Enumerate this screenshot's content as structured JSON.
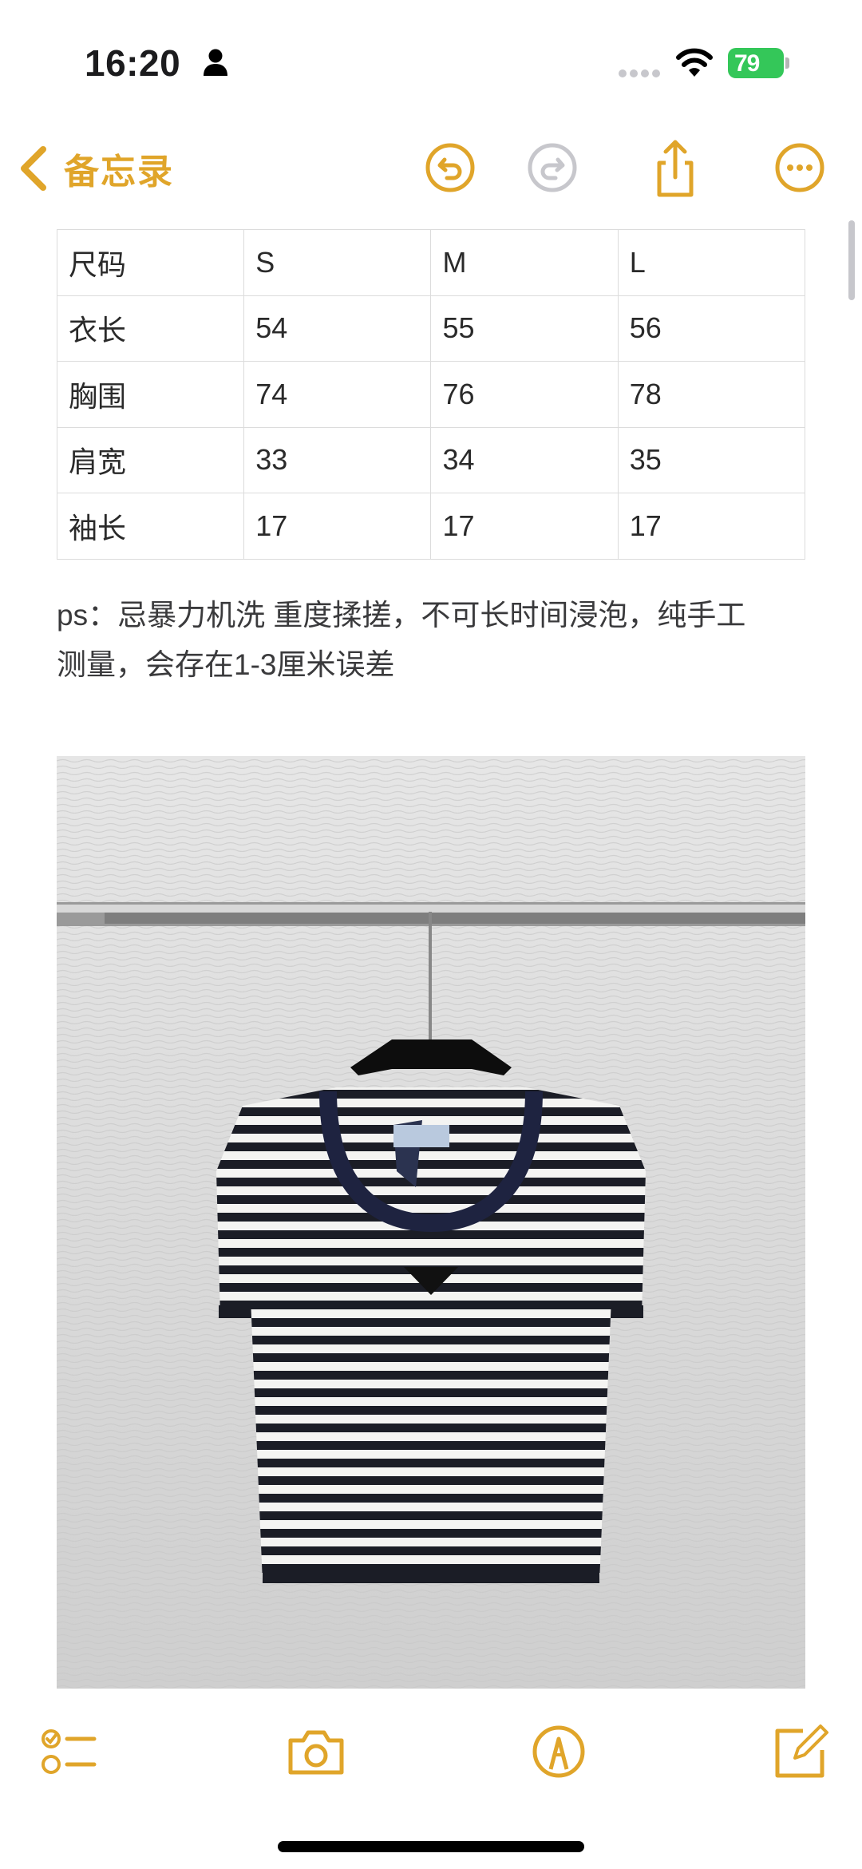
{
  "status_bar": {
    "time": "16:20",
    "battery": "79"
  },
  "nav": {
    "back_label": "备忘录",
    "icons": [
      "undo-icon",
      "redo-icon",
      "share-icon",
      "more-icon"
    ]
  },
  "colors": {
    "accent": "#E0A52A",
    "battery": "#34C759"
  },
  "table": {
    "rows": [
      [
        "尺码",
        "S",
        "M",
        "L"
      ],
      [
        "衣长",
        "54",
        "55",
        "56"
      ],
      [
        "胸围",
        "74",
        "76",
        "78"
      ],
      [
        "肩宽",
        "33",
        "34",
        "35"
      ],
      [
        "袖长",
        "17",
        "17",
        "17"
      ]
    ]
  },
  "note": {
    "line1": "ps：忌暴力机洗 重度揉搓，不可长时间浸泡，纯手工",
    "line2": "测量，会存在1-3厘米误差"
  },
  "toolbar": {
    "icons": [
      "checklist-icon",
      "camera-icon",
      "markup-icon",
      "compose-icon"
    ]
  }
}
